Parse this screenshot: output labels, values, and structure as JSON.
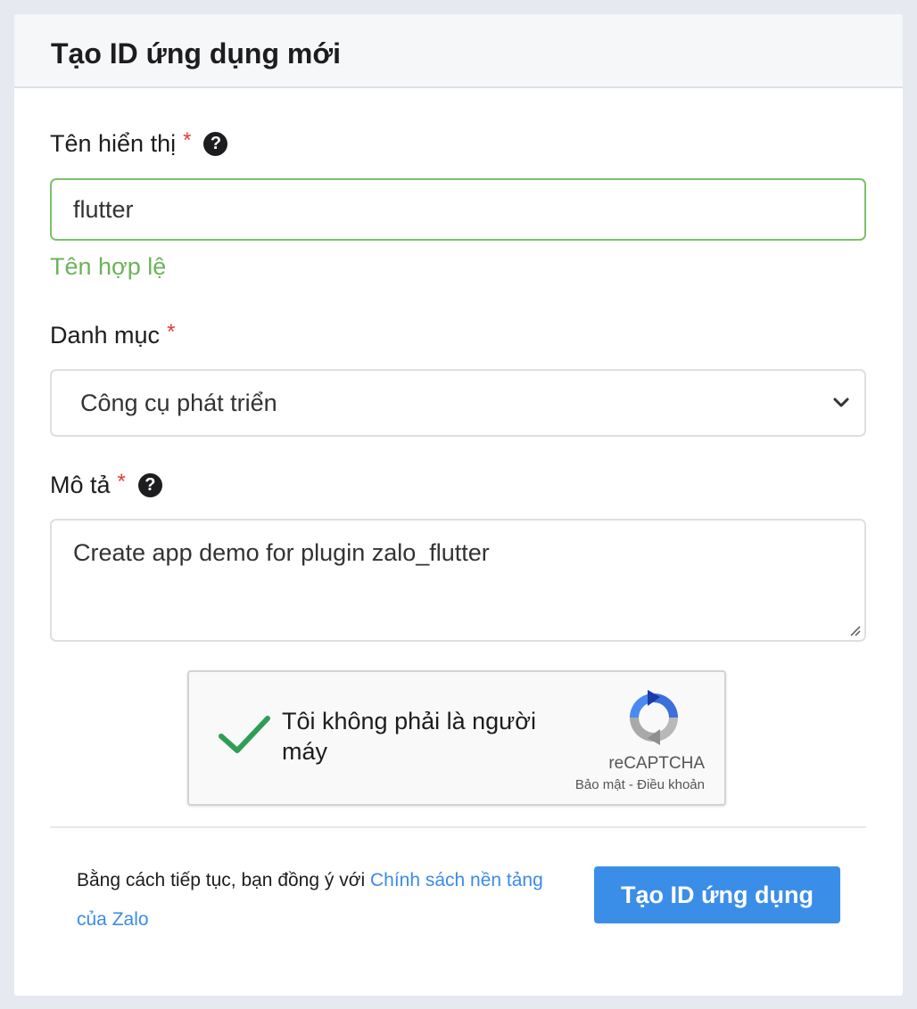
{
  "header": {
    "title": "Tạo ID ứng dụng mới"
  },
  "form": {
    "display_name": {
      "label": "Tên hiển thị",
      "required_mark": "*",
      "help_icon": "question-circle-icon",
      "value": "flutter",
      "validation_message": "Tên hợp lệ"
    },
    "category": {
      "label": "Danh mục",
      "required_mark": "*",
      "selected": "Công cụ phát triển"
    },
    "description": {
      "label": "Mô tả",
      "required_mark": "*",
      "help_icon": "question-circle-icon",
      "value": "Create app demo for plugin zalo_flutter"
    }
  },
  "captcha": {
    "text": "Tôi không phải là người máy",
    "brand": "reCAPTCHA",
    "privacy_link": "Bảo mật",
    "separator": " - ",
    "terms_link": "Điều khoản",
    "checked": true
  },
  "footer": {
    "terms_prefix": "Bằng cách tiếp tục, bạn đồng ý với ",
    "terms_link": "Chính sách nền tảng của Zalo",
    "submit_label": "Tạo ID ứng dụng"
  },
  "colors": {
    "valid": "#6cb35a",
    "required": "#e53935",
    "link": "#3b8be6",
    "primary_button": "#3b8ee8",
    "checkmark": "#2f9e55"
  }
}
